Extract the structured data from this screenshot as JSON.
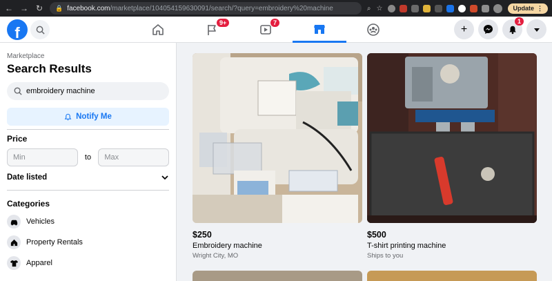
{
  "browser": {
    "url_host": "facebook.com",
    "url_path": "/marketplace/104054159630091/search/?query=embroidery%20machine",
    "update_label": "Update"
  },
  "fb": {
    "logo_letter": "f",
    "tabs": [
      {
        "name": "home",
        "badge": ""
      },
      {
        "name": "pages",
        "badge": "9+"
      },
      {
        "name": "watch",
        "badge": "7"
      },
      {
        "name": "marketplace",
        "badge": ""
      },
      {
        "name": "groups",
        "badge": ""
      }
    ],
    "notifications_badge": "1"
  },
  "sidebar": {
    "breadcrumb": "Marketplace",
    "heading": "Search Results",
    "search_value": "embroidery machine",
    "notify_label": "Notify Me",
    "price_label": "Price",
    "min_placeholder": "Min",
    "to_label": "to",
    "max_placeholder": "Max",
    "date_label": "Date listed",
    "categories_label": "Categories",
    "categories": [
      {
        "label": "Vehicles",
        "icon": "car-icon"
      },
      {
        "label": "Property Rentals",
        "icon": "house-icon"
      },
      {
        "label": "Apparel",
        "icon": "shirt-icon"
      }
    ]
  },
  "listings": [
    {
      "price": "$250",
      "title": "Embroidery machine",
      "location": "Wright City, MO"
    },
    {
      "price": "$500",
      "title": "T-shirt printing machine",
      "location": "Ships to you"
    }
  ],
  "colors": {
    "accent": "#1877f2",
    "badge": "#e41e3f"
  }
}
